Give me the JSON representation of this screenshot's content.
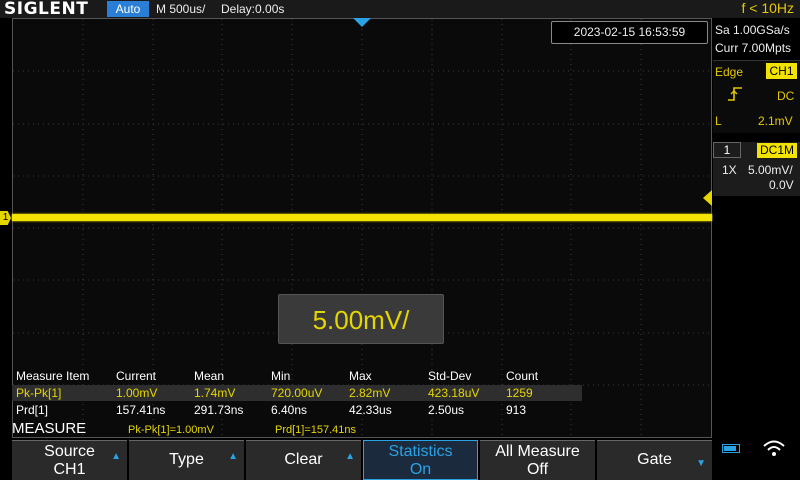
{
  "topbar": {
    "logo": "SIGLENT",
    "run_mode": "Auto",
    "timebase": "M 500us/",
    "delay": "Delay:0.00s",
    "freq": "f < 10Hz"
  },
  "timestamp": "2023-02-15 16:53:59",
  "acquisition": {
    "sample_rate": "Sa 1.00GSa/s",
    "memory": "Curr 7.00Mpts"
  },
  "trigger": {
    "type": "Edge",
    "source": "CH1",
    "coupling": "DC",
    "level_label": "L",
    "level": "2.1mV",
    "edge_icon": "rising-edge-icon"
  },
  "channel": {
    "number": "1",
    "coupling": "DC1M",
    "probe": "1X",
    "scale": "5.00mV/",
    "offset": "0.0V",
    "marker": "1",
    "color": "#f2e400"
  },
  "scale_popup": "5.00mV/",
  "measure": {
    "headers": [
      "Measure Item",
      "Current",
      "Mean",
      "Min",
      "Max",
      "Std-Dev",
      "Count"
    ],
    "rows": [
      [
        "Pk-Pk[1]",
        "1.00mV",
        "1.74mV",
        "720.00uV",
        "2.82mV",
        "423.18uV",
        "1259"
      ],
      [
        "Prd[1]",
        "157.41ns",
        "291.73ns",
        "6.40ns",
        "42.33us",
        "2.50us",
        "913"
      ]
    ],
    "title": "MEASURE",
    "readouts": [
      "Pk-Pk[1]=1.00mV",
      "Prd[1]=157.41ns"
    ]
  },
  "softkeys": [
    {
      "line1": "Source",
      "line2": "CH1",
      "arrow": "up"
    },
    {
      "line1": "Type",
      "line2": "",
      "arrow": "up"
    },
    {
      "line1": "Clear",
      "line2": "",
      "arrow": "up"
    },
    {
      "line1": "Statistics",
      "line2": "On",
      "arrow": ""
    },
    {
      "line1": "All Measure",
      "line2": "Off",
      "arrow": ""
    },
    {
      "line1": "Gate",
      "line2": "",
      "arrow": "down"
    }
  ],
  "colors": {
    "accent": "#2aa2e6",
    "trace": "#f2e400",
    "run_mode_bg": "#2b7ed6"
  }
}
